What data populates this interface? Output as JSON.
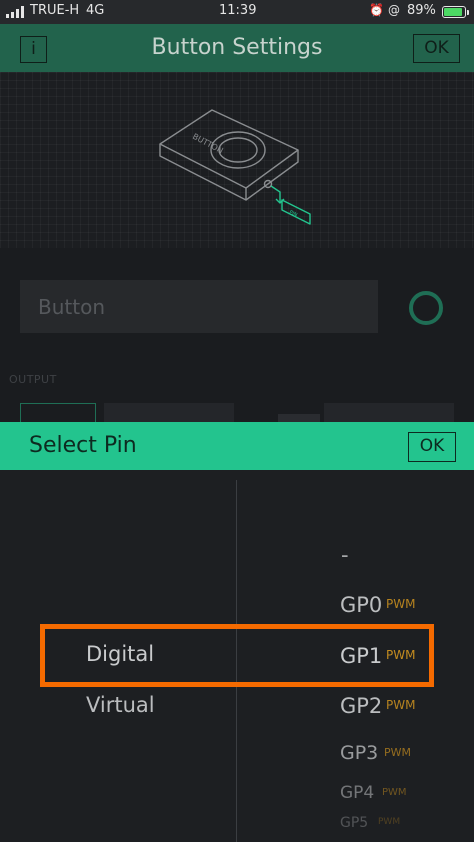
{
  "status_bar": {
    "carrier": "TRUE-H",
    "network": "4G",
    "time": "11:39",
    "battery_percent": "89%",
    "battery_level": 0.89
  },
  "header": {
    "title": "Button Settings",
    "info_label": "i",
    "ok_label": "OK"
  },
  "widget": {
    "device_label": "BUTTON",
    "pin_tag": "PIN"
  },
  "settings": {
    "name_value": "Button",
    "output_label": "OUTPUT"
  },
  "sheet": {
    "title": "Select Pin",
    "ok_label": "OK"
  },
  "picker": {
    "type_options": [
      {
        "label": "Digital",
        "selected": true
      },
      {
        "label": "Virtual",
        "selected": false
      }
    ],
    "pin_options": [
      {
        "label": "-",
        "badge": ""
      },
      {
        "label": "GP0",
        "badge": "PWM"
      },
      {
        "label": "GP1",
        "badge": "PWM",
        "selected": true
      },
      {
        "label": "GP2",
        "badge": "PWM"
      },
      {
        "label": "GP3",
        "badge": "PWM"
      },
      {
        "label": "GP4",
        "badge": "PWM"
      },
      {
        "label": "GP5",
        "badge": "PWM"
      }
    ]
  },
  "colors": {
    "header": "#22634c",
    "sheet_header": "#23c48e",
    "accent": "#23c48e",
    "pwm": "#c48c1f",
    "highlight": "#f56a00"
  }
}
